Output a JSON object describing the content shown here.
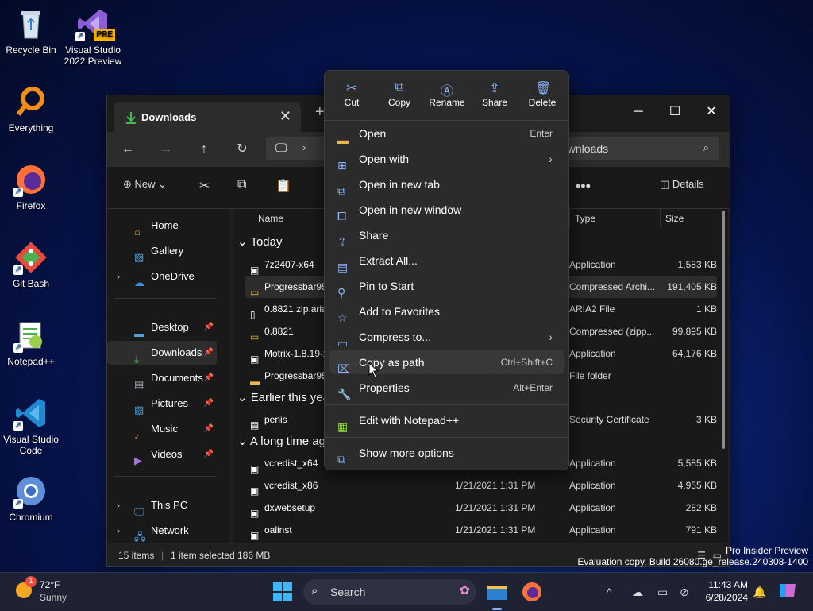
{
  "desktop": {
    "icons": [
      {
        "label": "Recycle Bin"
      },
      {
        "label": "Visual Studio 2022 Preview",
        "badge": "PRE"
      },
      {
        "label": "Everything"
      },
      {
        "label": "Firefox"
      },
      {
        "label": "Git Bash"
      },
      {
        "label": "Notepad++"
      },
      {
        "label": "Visual Studio Code"
      },
      {
        "label": "Chromium"
      }
    ],
    "watermark_line1": "Pro Insider Preview",
    "watermark_line2": "Evaluation copy. Build 26080.ge_release.240308-1400"
  },
  "explorer": {
    "tab_title": "Downloads",
    "search_placeholder": "ownloads",
    "toolbar": {
      "new_label": "New",
      "details_label": "Details"
    },
    "sidebar": {
      "items": [
        {
          "label": "Home",
          "icon": "home-icon"
        },
        {
          "label": "Gallery",
          "icon": "gallery-icon"
        },
        {
          "label": "OneDrive",
          "icon": "cloud-icon"
        },
        {
          "label": "Desktop",
          "icon": "desktop-icon"
        },
        {
          "label": "Downloads",
          "icon": "download-icon"
        },
        {
          "label": "Documents",
          "icon": "documents-icon"
        },
        {
          "label": "Pictures",
          "icon": "pictures-icon"
        },
        {
          "label": "Music",
          "icon": "music-icon"
        },
        {
          "label": "Videos",
          "icon": "videos-icon"
        },
        {
          "label": "This PC",
          "icon": "pc-icon"
        },
        {
          "label": "Network",
          "icon": "network-icon"
        }
      ]
    },
    "columns": {
      "name": "Name",
      "type": "Type",
      "size": "Size"
    },
    "groups": {
      "today": "Today",
      "earlier": "Earlier this yea",
      "long_ago": "A long time ag"
    },
    "files": [
      {
        "name": "7z2407-x64",
        "date": "",
        "type": "Application",
        "size": "1,583 KB"
      },
      {
        "name": "Progressbar95",
        "date": "",
        "type": "Compressed Archi...",
        "size": "191,405 KB"
      },
      {
        "name": "0.8821.zip.aria2",
        "date": "",
        "type": "ARIA2 File",
        "size": "1 KB"
      },
      {
        "name": "0.8821",
        "date": "",
        "type": "Compressed (zipp...",
        "size": "99,895 KB"
      },
      {
        "name": "Motrix-1.8.19-x",
        "date": "",
        "type": "Application",
        "size": "64,176 KB"
      },
      {
        "name": "Progressbar95",
        "date": "",
        "type": "File folder",
        "size": ""
      },
      {
        "name": "penis",
        "date": "",
        "type": "Security Certificate",
        "size": "3 KB"
      },
      {
        "name": "vcredist_x64",
        "date": "",
        "type": "Application",
        "size": "5,585 KB"
      },
      {
        "name": "vcredist_x86",
        "date": "1/21/2021 1:31 PM",
        "type": "Application",
        "size": "4,955 KB"
      },
      {
        "name": "dxwebsetup",
        "date": "1/21/2021 1:31 PM",
        "type": "Application",
        "size": "282 KB"
      },
      {
        "name": "oalinst",
        "date": "1/21/2021 1:31 PM",
        "type": "Application",
        "size": "791 KB"
      }
    ],
    "status": {
      "items": "15 items",
      "selected": "1 item selected",
      "size": "186 MB"
    }
  },
  "context_menu": {
    "quick_actions": [
      {
        "label": "Cut"
      },
      {
        "label": "Copy"
      },
      {
        "label": "Rename"
      },
      {
        "label": "Share"
      },
      {
        "label": "Delete"
      }
    ],
    "items": [
      {
        "label": "Open",
        "shortcut": "Enter"
      },
      {
        "label": "Open with",
        "shortcut": ""
      },
      {
        "label": "Open in new tab",
        "shortcut": ""
      },
      {
        "label": "Open in new window",
        "shortcut": ""
      },
      {
        "label": "Share",
        "shortcut": ""
      },
      {
        "label": "Extract All...",
        "shortcut": ""
      },
      {
        "label": "Pin to Start",
        "shortcut": ""
      },
      {
        "label": "Add to Favorites",
        "shortcut": ""
      },
      {
        "label": "Compress to...",
        "shortcut": ""
      },
      {
        "label": "Copy as path",
        "shortcut": "Ctrl+Shift+C"
      },
      {
        "label": "Properties",
        "shortcut": "Alt+Enter"
      },
      {
        "label": "Edit with Notepad++",
        "shortcut": ""
      },
      {
        "label": "Show more options",
        "shortcut": ""
      }
    ]
  },
  "taskbar": {
    "weather_temp": "72°F",
    "weather_cond": "Sunny",
    "weather_badge": "1",
    "search_label": "Search",
    "time": "11:43 AM",
    "date": "6/28/2024"
  }
}
